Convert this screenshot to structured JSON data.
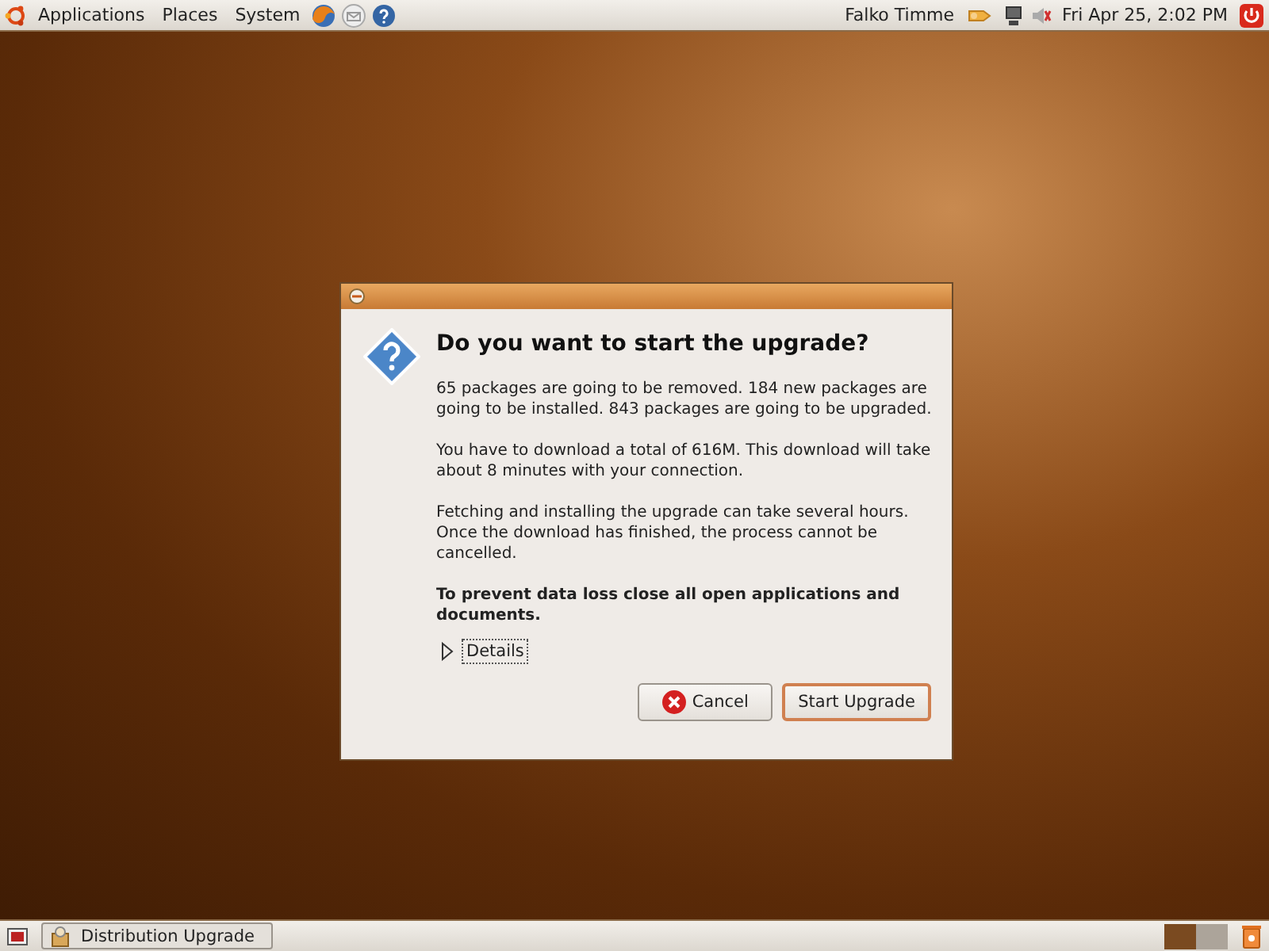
{
  "top_panel": {
    "menus": [
      "Applications",
      "Places",
      "System"
    ],
    "user": "Falko Timme",
    "clock": "Fri Apr 25,  2:02 PM"
  },
  "dialog": {
    "heading": "Do you want to start the upgrade?",
    "paragraphs": [
      {
        "text": "65 packages are going to be removed. 184 new packages are going to be installed. 843 packages are going to be upgraded.",
        "bold": false
      },
      {
        "text": "You have to download a total of 616M. This download will take about 8 minutes with your connection.",
        "bold": false
      },
      {
        "text": "Fetching and installing the upgrade can take several hours. Once the download has finished, the process cannot be cancelled.",
        "bold": false
      },
      {
        "text": "To prevent data loss close all open applications and documents.",
        "bold": true
      }
    ],
    "details": {
      "label": "Details",
      "expanded": false
    },
    "buttons": [
      {
        "label": "Cancel",
        "kind": "cancel",
        "default": false
      },
      {
        "label": "Start Upgrade",
        "kind": "plain",
        "default": true
      }
    ]
  },
  "bottom_panel": {
    "tasks": [
      {
        "label": "Distribution Upgrade"
      }
    ],
    "workspaces": [
      {
        "selected": true
      },
      {
        "selected": false
      }
    ]
  }
}
